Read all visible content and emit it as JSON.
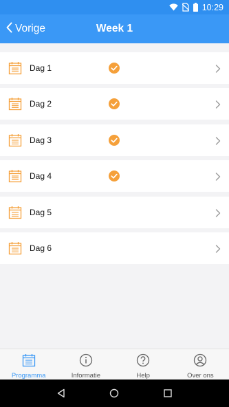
{
  "status_bar": {
    "time": "10:29"
  },
  "header": {
    "back_label": "Vorige",
    "title": "Week 1"
  },
  "days": [
    {
      "label": "Dag 1",
      "completed": true
    },
    {
      "label": "Dag 2",
      "completed": true
    },
    {
      "label": "Dag 3",
      "completed": true
    },
    {
      "label": "Dag 4",
      "completed": true
    },
    {
      "label": "Dag 5",
      "completed": false
    },
    {
      "label": "Dag 6",
      "completed": false
    }
  ],
  "tabbar": {
    "programma": "Programma",
    "informatie": "Informatie",
    "help": "Help",
    "over_ons": "Over ons",
    "active": "programma"
  },
  "colors": {
    "primary": "#3a98f6",
    "status_bar": "#2f8ff0",
    "accent_orange": "#f5a03a",
    "background": "#f3f3f5"
  }
}
